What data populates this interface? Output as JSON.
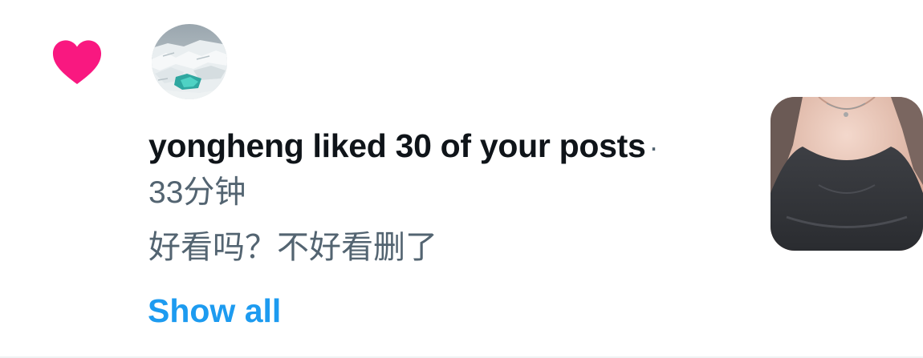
{
  "notification": {
    "icon": "heart-icon",
    "accent_color": "#f91880",
    "avatar": {
      "icon": "avatar-ice-landscape"
    },
    "headline": "yongheng liked 30 of your posts",
    "separator": "·",
    "time": "33分钟",
    "post_text": "好看吗？不好看删了",
    "show_all_label": "Show all",
    "link_color": "#1d9bf0",
    "text_color": "#0f1419",
    "secondary_color": "#536471",
    "thumbnail": {
      "icon": "post-thumbnail-image"
    }
  }
}
